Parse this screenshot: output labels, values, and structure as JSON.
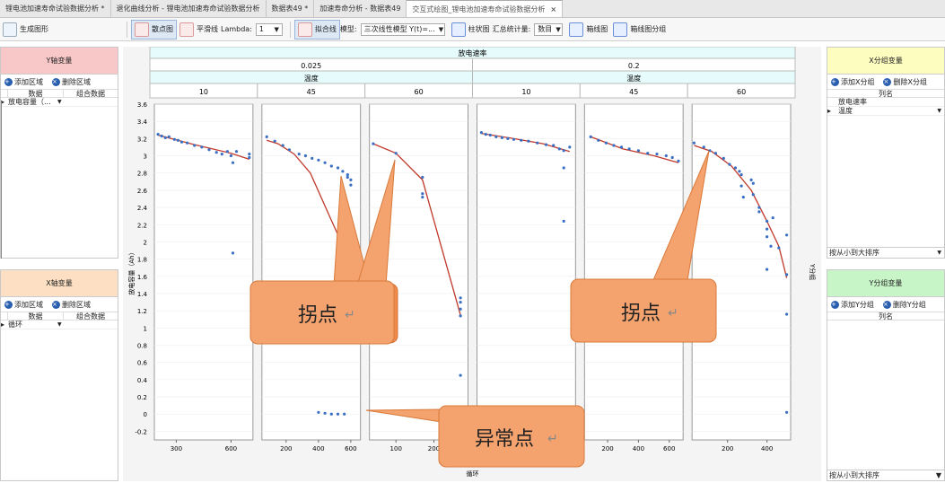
{
  "tabs": [
    {
      "label": "锂电池加速寿命试验数据分析 *"
    },
    {
      "label": "退化曲线分析 - 锂电池加速寿命试验数据分析"
    },
    {
      "label": "数据表49 *"
    },
    {
      "label": "加速寿命分析 - 数据表49"
    },
    {
      "label": "交互式绘图_锂电池加速寿命试验数据分析",
      "close": "×"
    }
  ],
  "toolbar": {
    "generate": "生成图形",
    "scatter": "散点图",
    "smooth": "平滑线",
    "lambda_label": "Lambda:",
    "lambda_value": "1",
    "fit": "拟合线",
    "model_label": "模型:",
    "model_value": "三次线性模型 Y(t)=...",
    "bar": "柱状图",
    "summary_label": "汇总统计量:",
    "summary_value": "数目",
    "box": "箱线图",
    "box_group": "箱线图分组"
  },
  "y_panel": {
    "title": "Y轴变量",
    "add": "添加区域",
    "del": "删除区域",
    "col1": "数据",
    "col2": "组合数据",
    "row": "放电容量（..."
  },
  "x_panel": {
    "title": "X轴变量",
    "add": "添加区域",
    "del": "删除区域",
    "col1": "数据",
    "col2": "组合数据",
    "row": "循环"
  },
  "xg_panel": {
    "title": "X分组变量",
    "add": "添加X分组",
    "del": "删除X分组",
    "col": "列名",
    "r1": "放电速率",
    "r2": "温度",
    "sort": "按从小到大排序"
  },
  "yg_panel": {
    "title": "Y分组变量",
    "add": "添加Y分组",
    "del": "删除Y分组",
    "col": "列名",
    "sort": "按从小到大排序"
  },
  "chart_data": {
    "type": "scatter",
    "top_group": "放电速率",
    "rates": [
      "0.025",
      "0.2"
    ],
    "second_group": "温度",
    "temps": [
      "10",
      "45",
      "60"
    ],
    "ylabel": "放电容量（Ah）",
    "xlabel": "循环",
    "right_label": "Y分组",
    "ylim": [
      -0.3,
      3.6
    ],
    "yticks": [
      "3.6",
      "3.4",
      "3.2",
      "3",
      "2.8",
      "2.6",
      "2.4",
      "2.2",
      "2",
      "1.8",
      "1.6",
      "1.4",
      "1.2",
      "1",
      "0.8",
      "0.6",
      "0.4",
      "0.2",
      "0",
      "-0.2"
    ],
    "panels": [
      {
        "xlim": [
          180,
          720
        ],
        "xticks": [
          300,
          600
        ],
        "fit": [
          [
            200,
            3.24
          ],
          [
            400,
            3.13
          ],
          [
            600,
            3.03
          ],
          [
            700,
            2.96
          ]
        ],
        "points": [
          [
            200,
            3.25
          ],
          [
            220,
            3.23
          ],
          [
            240,
            3.21
          ],
          [
            260,
            3.22
          ],
          [
            290,
            3.19
          ],
          [
            310,
            3.18
          ],
          [
            330,
            3.16
          ],
          [
            360,
            3.15
          ],
          [
            400,
            3.12
          ],
          [
            440,
            3.1
          ],
          [
            480,
            3.07
          ],
          [
            520,
            3.04
          ],
          [
            550,
            3.02
          ],
          [
            580,
            3.05
          ],
          [
            600,
            3.0
          ],
          [
            610,
            2.92
          ],
          [
            630,
            3.05
          ],
          [
            700,
            3.02
          ],
          [
            700,
            2.98
          ],
          [
            610,
            1.87
          ]
        ]
      },
      {
        "xlim": [
          50,
          660
        ],
        "xticks": [
          200,
          400,
          600
        ],
        "fit": [
          [
            80,
            3.18
          ],
          [
            150,
            3.14
          ],
          [
            250,
            3.02
          ],
          [
            350,
            2.8
          ],
          [
            480,
            2.25
          ],
          [
            540,
            2.0
          ]
        ],
        "points": [
          [
            80,
            3.22
          ],
          [
            130,
            3.17
          ],
          [
            180,
            3.12
          ],
          [
            220,
            3.07
          ],
          [
            280,
            3.02
          ],
          [
            320,
            3.0
          ],
          [
            360,
            2.97
          ],
          [
            400,
            2.95
          ],
          [
            440,
            2.92
          ],
          [
            480,
            2.88
          ],
          [
            520,
            2.86
          ],
          [
            550,
            2.82
          ],
          [
            580,
            2.78
          ],
          [
            600,
            2.72
          ],
          [
            600,
            2.66
          ],
          [
            580,
            2.75
          ],
          [
            400,
            0.02
          ],
          [
            440,
            0.01
          ],
          [
            480,
            0.0
          ],
          [
            520,
            0.0
          ],
          [
            560,
            0.0
          ]
        ]
      },
      {
        "xlim": [
          30,
          290
        ],
        "xticks": [
          100,
          200
        ],
        "fit": [
          [
            40,
            3.14
          ],
          [
            100,
            3.03
          ],
          [
            170,
            2.72
          ],
          [
            270,
            1.15
          ]
        ],
        "points": [
          [
            40,
            3.14
          ],
          [
            100,
            3.03
          ],
          [
            170,
            2.75
          ],
          [
            170,
            2.56
          ],
          [
            170,
            2.52
          ],
          [
            270,
            1.35
          ],
          [
            270,
            1.3
          ],
          [
            270,
            1.22
          ],
          [
            270,
            1.14
          ],
          [
            270,
            0.45
          ]
        ]
      },
      {
        "xlim": [
          50,
          720
        ],
        "xticks": [
          200,
          400,
          600
        ],
        "fit": [
          [
            80,
            3.26
          ],
          [
            300,
            3.2
          ],
          [
            500,
            3.14
          ],
          [
            680,
            3.05
          ]
        ],
        "points": [
          [
            80,
            3.27
          ],
          [
            110,
            3.25
          ],
          [
            140,
            3.24
          ],
          [
            180,
            3.22
          ],
          [
            220,
            3.21
          ],
          [
            260,
            3.2
          ],
          [
            300,
            3.19
          ],
          [
            350,
            3.18
          ],
          [
            400,
            3.17
          ],
          [
            460,
            3.15
          ],
          [
            520,
            3.13
          ],
          [
            570,
            3.12
          ],
          [
            610,
            3.08
          ],
          [
            640,
            3.06
          ],
          [
            680,
            3.1
          ],
          [
            640,
            2.86
          ],
          [
            640,
            2.24
          ]
        ]
      },
      {
        "xlim": [
          50,
          690
        ],
        "xticks": [
          200,
          400,
          600
        ],
        "fit": [
          [
            90,
            3.22
          ],
          [
            300,
            3.08
          ],
          [
            500,
            3.0
          ],
          [
            660,
            2.92
          ]
        ],
        "points": [
          [
            90,
            3.22
          ],
          [
            140,
            3.18
          ],
          [
            190,
            3.15
          ],
          [
            240,
            3.12
          ],
          [
            290,
            3.1
          ],
          [
            340,
            3.08
          ],
          [
            400,
            3.06
          ],
          [
            460,
            3.03
          ],
          [
            520,
            3.02
          ],
          [
            580,
            3.0
          ],
          [
            620,
            2.98
          ],
          [
            660,
            2.94
          ]
        ]
      },
      {
        "xlim": [
          20,
          520
        ],
        "xticks": [
          200,
          400
        ],
        "fit": [
          [
            30,
            3.12
          ],
          [
            120,
            3.05
          ],
          [
            220,
            2.88
          ],
          [
            320,
            2.6
          ],
          [
            400,
            2.24
          ],
          [
            460,
            1.95
          ],
          [
            500,
            1.58
          ]
        ],
        "points": [
          [
            30,
            3.15
          ],
          [
            80,
            3.1
          ],
          [
            110,
            3.06
          ],
          [
            140,
            3.03
          ],
          [
            180,
            2.97
          ],
          [
            210,
            2.9
          ],
          [
            240,
            2.86
          ],
          [
            260,
            2.82
          ],
          [
            270,
            2.78
          ],
          [
            270,
            2.65
          ],
          [
            280,
            2.52
          ],
          [
            320,
            2.72
          ],
          [
            330,
            2.68
          ],
          [
            330,
            2.55
          ],
          [
            360,
            2.4
          ],
          [
            360,
            2.35
          ],
          [
            400,
            2.24
          ],
          [
            400,
            2.15
          ],
          [
            400,
            2.06
          ],
          [
            420,
            1.95
          ],
          [
            400,
            1.68
          ],
          [
            430,
            2.28
          ],
          [
            460,
            1.93
          ],
          [
            500,
            2.08
          ],
          [
            500,
            1.62
          ],
          [
            500,
            1.16
          ],
          [
            500,
            0.02
          ]
        ]
      }
    ]
  },
  "callouts": {
    "knee1": "拐点",
    "knee2": "拐点",
    "outlier": "异常点",
    "enter": "↵"
  }
}
